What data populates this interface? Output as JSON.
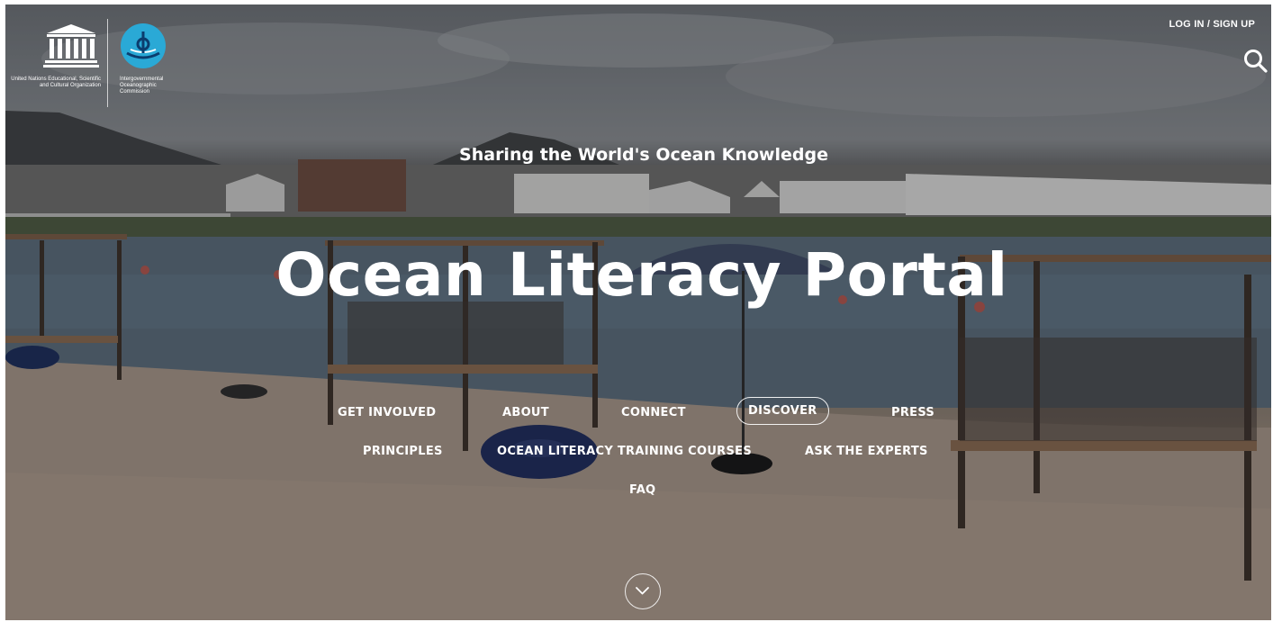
{
  "header": {
    "unesco_logo_text": "United Nations Educational, Scientific and Cultural Organization",
    "ioc_logo_text": "Intergovernmental Oceanographic Commission",
    "login_label": "LOG IN / SIGN UP",
    "search_icon": "search-icon"
  },
  "hero": {
    "tagline": "Sharing the World's Ocean Knowledge",
    "title": "Ocean Literacy Portal"
  },
  "nav": {
    "row1": [
      "GET INVOLVED",
      "ABOUT",
      "CONNECT",
      "DISCOVER",
      "PRESS"
    ],
    "row2": [
      "PRINCIPLES",
      "OCEAN LITERACY TRAINING COURSES",
      "ASK THE EXPERTS"
    ],
    "row3": [
      "FAQ"
    ],
    "active": "DISCOVER"
  },
  "scroll_icon": "chevron-down-icon",
  "colors": {
    "text": "#ffffff",
    "ioc_blue": "#2aa9d6"
  }
}
